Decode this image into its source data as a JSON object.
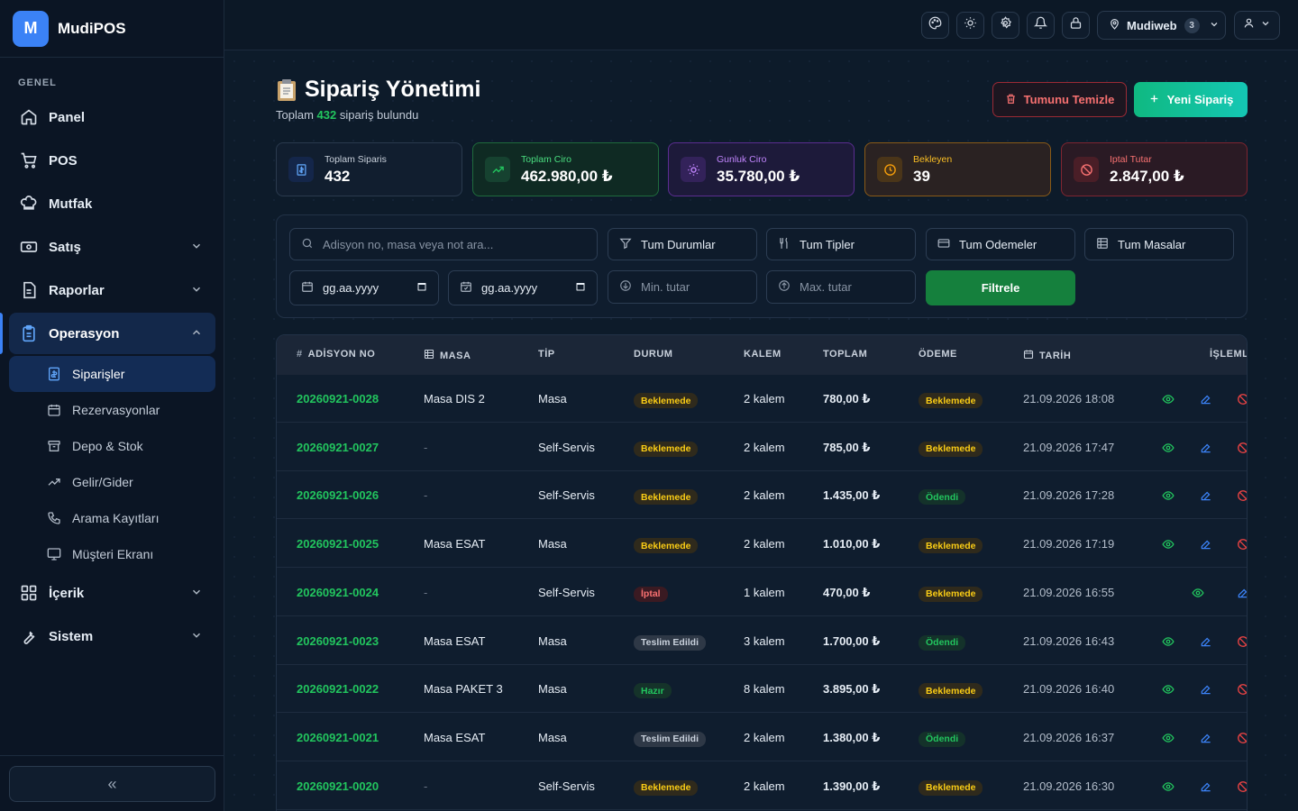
{
  "brand": {
    "logo": "M",
    "name": "MudiPOS"
  },
  "sidebar": {
    "section": "GENEL",
    "items": [
      {
        "label": "Panel",
        "icon": "home-icon"
      },
      {
        "label": "POS",
        "icon": "cart-icon"
      },
      {
        "label": "Mutfak",
        "icon": "chef-hat-icon"
      },
      {
        "label": "Satış",
        "icon": "money-icon"
      },
      {
        "label": "Raporlar",
        "icon": "report-icon"
      },
      {
        "label": "Operasyon",
        "icon": "clipboard-icon"
      },
      {
        "label": "İçerik",
        "icon": "grid-icon"
      },
      {
        "label": "Sistem",
        "icon": "wrench-icon"
      }
    ],
    "sub_items": [
      {
        "label": "Siparişler",
        "icon": "receipt-icon"
      },
      {
        "label": "Rezervasyonlar",
        "icon": "calendar-icon"
      },
      {
        "label": "Depo & Stok",
        "icon": "box-icon"
      },
      {
        "label": "Gelir/Gider",
        "icon": "trend-icon"
      },
      {
        "label": "Arama Kayıtları",
        "icon": "phone-icon"
      },
      {
        "label": "Müşteri Ekranı",
        "icon": "monitor-icon"
      }
    ],
    "collapse_label": "«"
  },
  "topbar": {
    "location": "Mudiweb",
    "location_count": "3"
  },
  "page": {
    "title": "Sipariş Yönetimi",
    "subtitle_prefix": "Toplam",
    "subtitle_count": "432",
    "subtitle_suffix": "sipariş bulundu",
    "clear_label": "Tumunu Temizle",
    "new_label": "Yeni Sipariş"
  },
  "stats": [
    {
      "label": "Toplam Siparis",
      "value": "432",
      "color": "#60a5fa"
    },
    {
      "label": "Toplam Ciro",
      "value": "462.980,00 ₺",
      "color": "#22c55e"
    },
    {
      "label": "Gunluk Ciro",
      "value": "35.780,00 ₺",
      "color": "#a855f7"
    },
    {
      "label": "Bekleyen",
      "value": "39",
      "color": "#f59e0b"
    },
    {
      "label": "Iptal Tutar",
      "value": "2.847,00 ₺",
      "color": "#ef4444"
    }
  ],
  "filters": {
    "search_placeholder": "Adisyon no, masa veya not ara...",
    "status": "Tum Durumlar",
    "type": "Tum Tipler",
    "payment": "Tum Odemeler",
    "table": "Tum Masalar",
    "date_from": "gg.aa.yyyy",
    "date_to": "gg.aa.yyyy",
    "min_placeholder": "Min. tutar",
    "max_placeholder": "Max. tutar",
    "filter_label": "Filtrele"
  },
  "table": {
    "headers": [
      "ADİSYON NO",
      "MASA",
      "TİP",
      "DURUM",
      "KALEM",
      "TOPLAM",
      "ÖDEME",
      "TARİH",
      "İŞLEML"
    ],
    "rows": [
      {
        "no": "20260921-0028",
        "masa": "Masa DIS 2",
        "tip": "Masa",
        "durum": "Beklemede",
        "kalem": "2 kalem",
        "toplam": "780,00 ₺",
        "odeme": "Beklemede",
        "tarih": "21.09.2026 18:08"
      },
      {
        "no": "20260921-0027",
        "masa": "-",
        "tip": "Self-Servis",
        "durum": "Beklemede",
        "kalem": "2 kalem",
        "toplam": "785,00 ₺",
        "odeme": "Beklemede",
        "tarih": "21.09.2026 17:47"
      },
      {
        "no": "20260921-0026",
        "masa": "-",
        "tip": "Self-Servis",
        "durum": "Beklemede",
        "kalem": "2 kalem",
        "toplam": "1.435,00 ₺",
        "odeme": "Ödendi",
        "tarih": "21.09.2026 17:28"
      },
      {
        "no": "20260921-0025",
        "masa": "Masa ESAT",
        "tip": "Masa",
        "durum": "Beklemede",
        "kalem": "2 kalem",
        "toplam": "1.010,00 ₺",
        "odeme": "Beklemede",
        "tarih": "21.09.2026 17:19"
      },
      {
        "no": "20260921-0024",
        "masa": "-",
        "tip": "Self-Servis",
        "durum": "İptal",
        "kalem": "1 kalem",
        "toplam": "470,00 ₺",
        "odeme": "Beklemede",
        "tarih": "21.09.2026 16:55"
      },
      {
        "no": "20260921-0023",
        "masa": "Masa ESAT",
        "tip": "Masa",
        "durum": "Teslim Edildi",
        "kalem": "3 kalem",
        "toplam": "1.700,00 ₺",
        "odeme": "Ödendi",
        "tarih": "21.09.2026 16:43"
      },
      {
        "no": "20260921-0022",
        "masa": "Masa PAKET 3",
        "tip": "Masa",
        "durum": "Hazır",
        "kalem": "8 kalem",
        "toplam": "3.895,00 ₺",
        "odeme": "Beklemede",
        "tarih": "21.09.2026 16:40"
      },
      {
        "no": "20260921-0021",
        "masa": "Masa ESAT",
        "tip": "Masa",
        "durum": "Teslim Edildi",
        "kalem": "2 kalem",
        "toplam": "1.380,00 ₺",
        "odeme": "Ödendi",
        "tarih": "21.09.2026 16:37"
      },
      {
        "no": "20260921-0020",
        "masa": "-",
        "tip": "Self-Servis",
        "durum": "Beklemede",
        "kalem": "2 kalem",
        "toplam": "1.390,00 ₺",
        "odeme": "Beklemede",
        "tarih": "21.09.2026 16:30"
      }
    ]
  }
}
